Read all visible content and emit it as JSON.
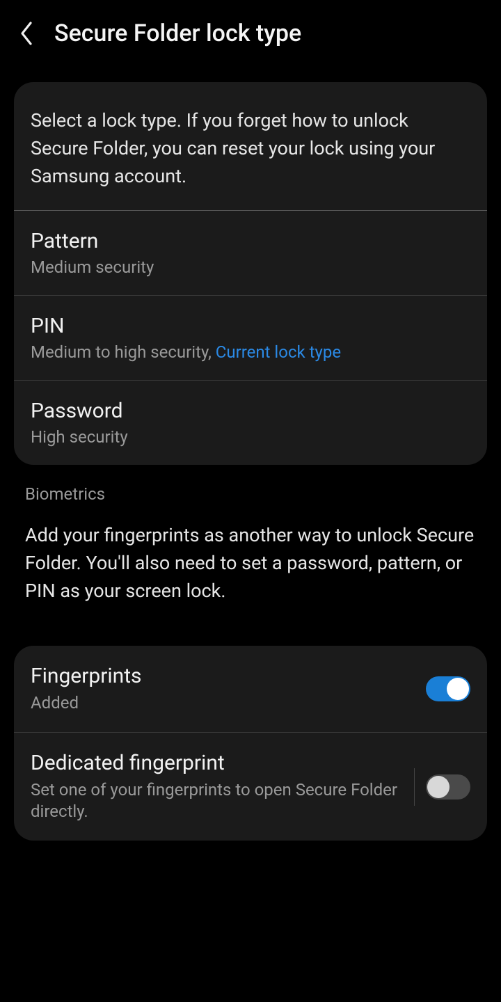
{
  "header": {
    "title": "Secure Folder lock type"
  },
  "intro": "Select a lock type. If you forget how to unlock Secure Folder, you can reset your lock using your Samsung account.",
  "options": {
    "pattern": {
      "title": "Pattern",
      "sub": "Medium security"
    },
    "pin": {
      "title": "PIN",
      "sub_prefix": "Medium to high security, ",
      "current": "Current lock type"
    },
    "password": {
      "title": "Password",
      "sub": "High security"
    }
  },
  "biometrics": {
    "label": "Biometrics",
    "desc": "Add your fingerprints as another way to unlock Secure Folder. You'll also need to set a password, pattern, or PIN as your screen lock.",
    "fingerprints": {
      "title": "Fingerprints",
      "sub": "Added"
    },
    "dedicated": {
      "title": "Dedicated fingerprint",
      "sub": "Set one of your fingerprints to open Secure Folder directly."
    }
  }
}
